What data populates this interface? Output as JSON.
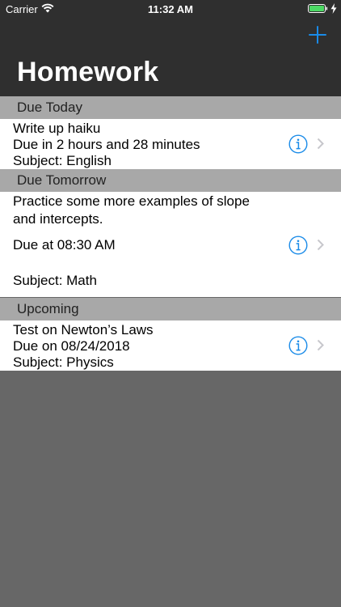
{
  "status_bar": {
    "carrier": "Carrier",
    "time": "11:32 AM"
  },
  "nav": {
    "title": "Homework",
    "add_icon": "plus-icon"
  },
  "sections": [
    {
      "header": "Due Today",
      "items": [
        {
          "title": "Write up haiku",
          "due": "Due in 2 hours and 28 minutes",
          "subject": "Subject: English"
        }
      ]
    },
    {
      "header": "Due Tomorrow",
      "items": [
        {
          "title_line1": "Practice some more examples of slope",
          "title_line2": "and intercepts.",
          "due": "Due at 08:30 AM",
          "subject": "Subject: Math"
        }
      ]
    },
    {
      "header": "Upcoming",
      "items": [
        {
          "title": "Test on Newton’s Laws",
          "due": "Due on 08/24/2018",
          "subject": "Subject: Physics"
        }
      ]
    }
  ],
  "colors": {
    "nav_background": "#2f2f2f",
    "section_header": "#a8a8a8",
    "accent": "#1a8be8",
    "empty_background": "#676767"
  }
}
